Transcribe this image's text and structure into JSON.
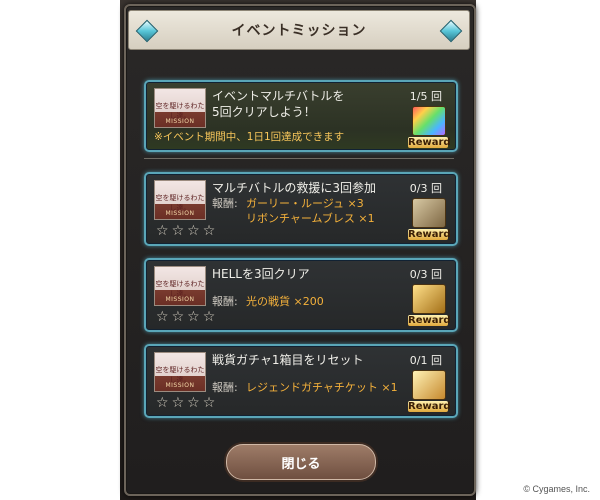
{
  "dialog": {
    "title": "イベントミッション",
    "close_label": "閉じる"
  },
  "thumb": {
    "caption": "空を駆けるわたし達。",
    "mission_label": "MISSION"
  },
  "reward_label": "Reward",
  "missions": [
    {
      "title_line1": "イベントマルチバトルを",
      "title_line2": "5回クリアしよう！",
      "progress": "1/5 回",
      "note": "※イベント期間中、1日1回達成できます"
    },
    {
      "title": "マルチバトルの救援に3回参加",
      "progress": "0/3 回",
      "reward_label": "報酬:",
      "reward_line1": "ガーリー・ルージュ ×3",
      "reward_line2": "リボンチャームブレス ×1",
      "stars": [
        "☆",
        "☆",
        "☆",
        "☆"
      ]
    },
    {
      "title": "HELLを3回クリア",
      "progress": "0/3 回",
      "reward_label": "報酬:",
      "reward_line1": "光の戦貨 ×200",
      "stars": [
        "☆",
        "☆",
        "☆",
        "☆"
      ]
    },
    {
      "title": "戦貨ガチャ1箱目をリセット",
      "progress": "0/1 回",
      "reward_label": "報酬:",
      "reward_line1": "レジェンドガチャチケット ×1",
      "stars": [
        "☆",
        "☆",
        "☆",
        "☆"
      ]
    }
  ],
  "copyright": "© Cygames, Inc."
}
